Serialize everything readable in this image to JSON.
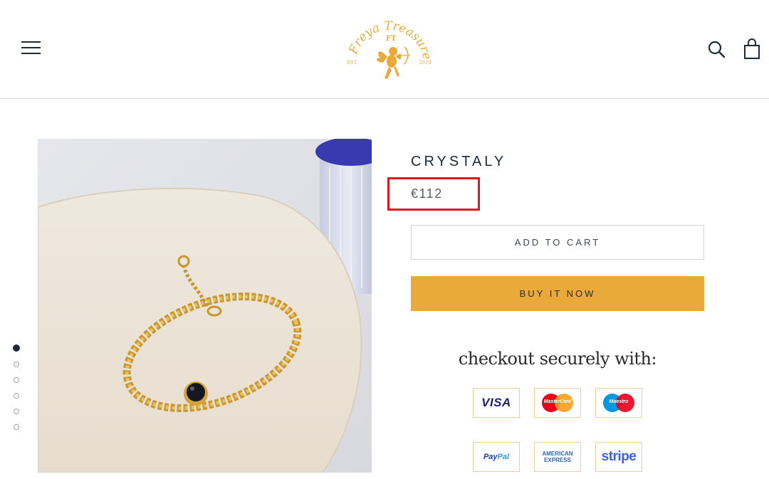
{
  "header": {
    "logo": {
      "brand_name": "Freya Treasures",
      "monogram": "FT",
      "est_label": "EST",
      "year": "2018"
    },
    "menu_icon": "hamburger-menu-icon",
    "search_icon": "search-icon",
    "cart_icon": "shopping-bag-icon"
  },
  "gallery": {
    "image_description_icon": "gold-bracelet-photo",
    "slide_count": 6,
    "active_slide": 1
  },
  "product": {
    "title": "CRYSTALY",
    "price": "€112"
  },
  "actions": {
    "add_to_cart_label": "ADD TO CART",
    "buy_now_label": "BUY IT NOW"
  },
  "checkout": {
    "heading": "checkout securely with:",
    "methods": {
      "visa": "VISA",
      "mastercard": "MasterCard",
      "maestro": "Maestro",
      "paypal_a": "Pay",
      "paypal_b": "Pal",
      "amex_line1": "AMERICAN",
      "amex_line2": "EXPRESS",
      "stripe": "stripe"
    }
  },
  "colors": {
    "accent": "#eaaa39",
    "text": "#1c2b39",
    "highlight": "#e3161f"
  }
}
